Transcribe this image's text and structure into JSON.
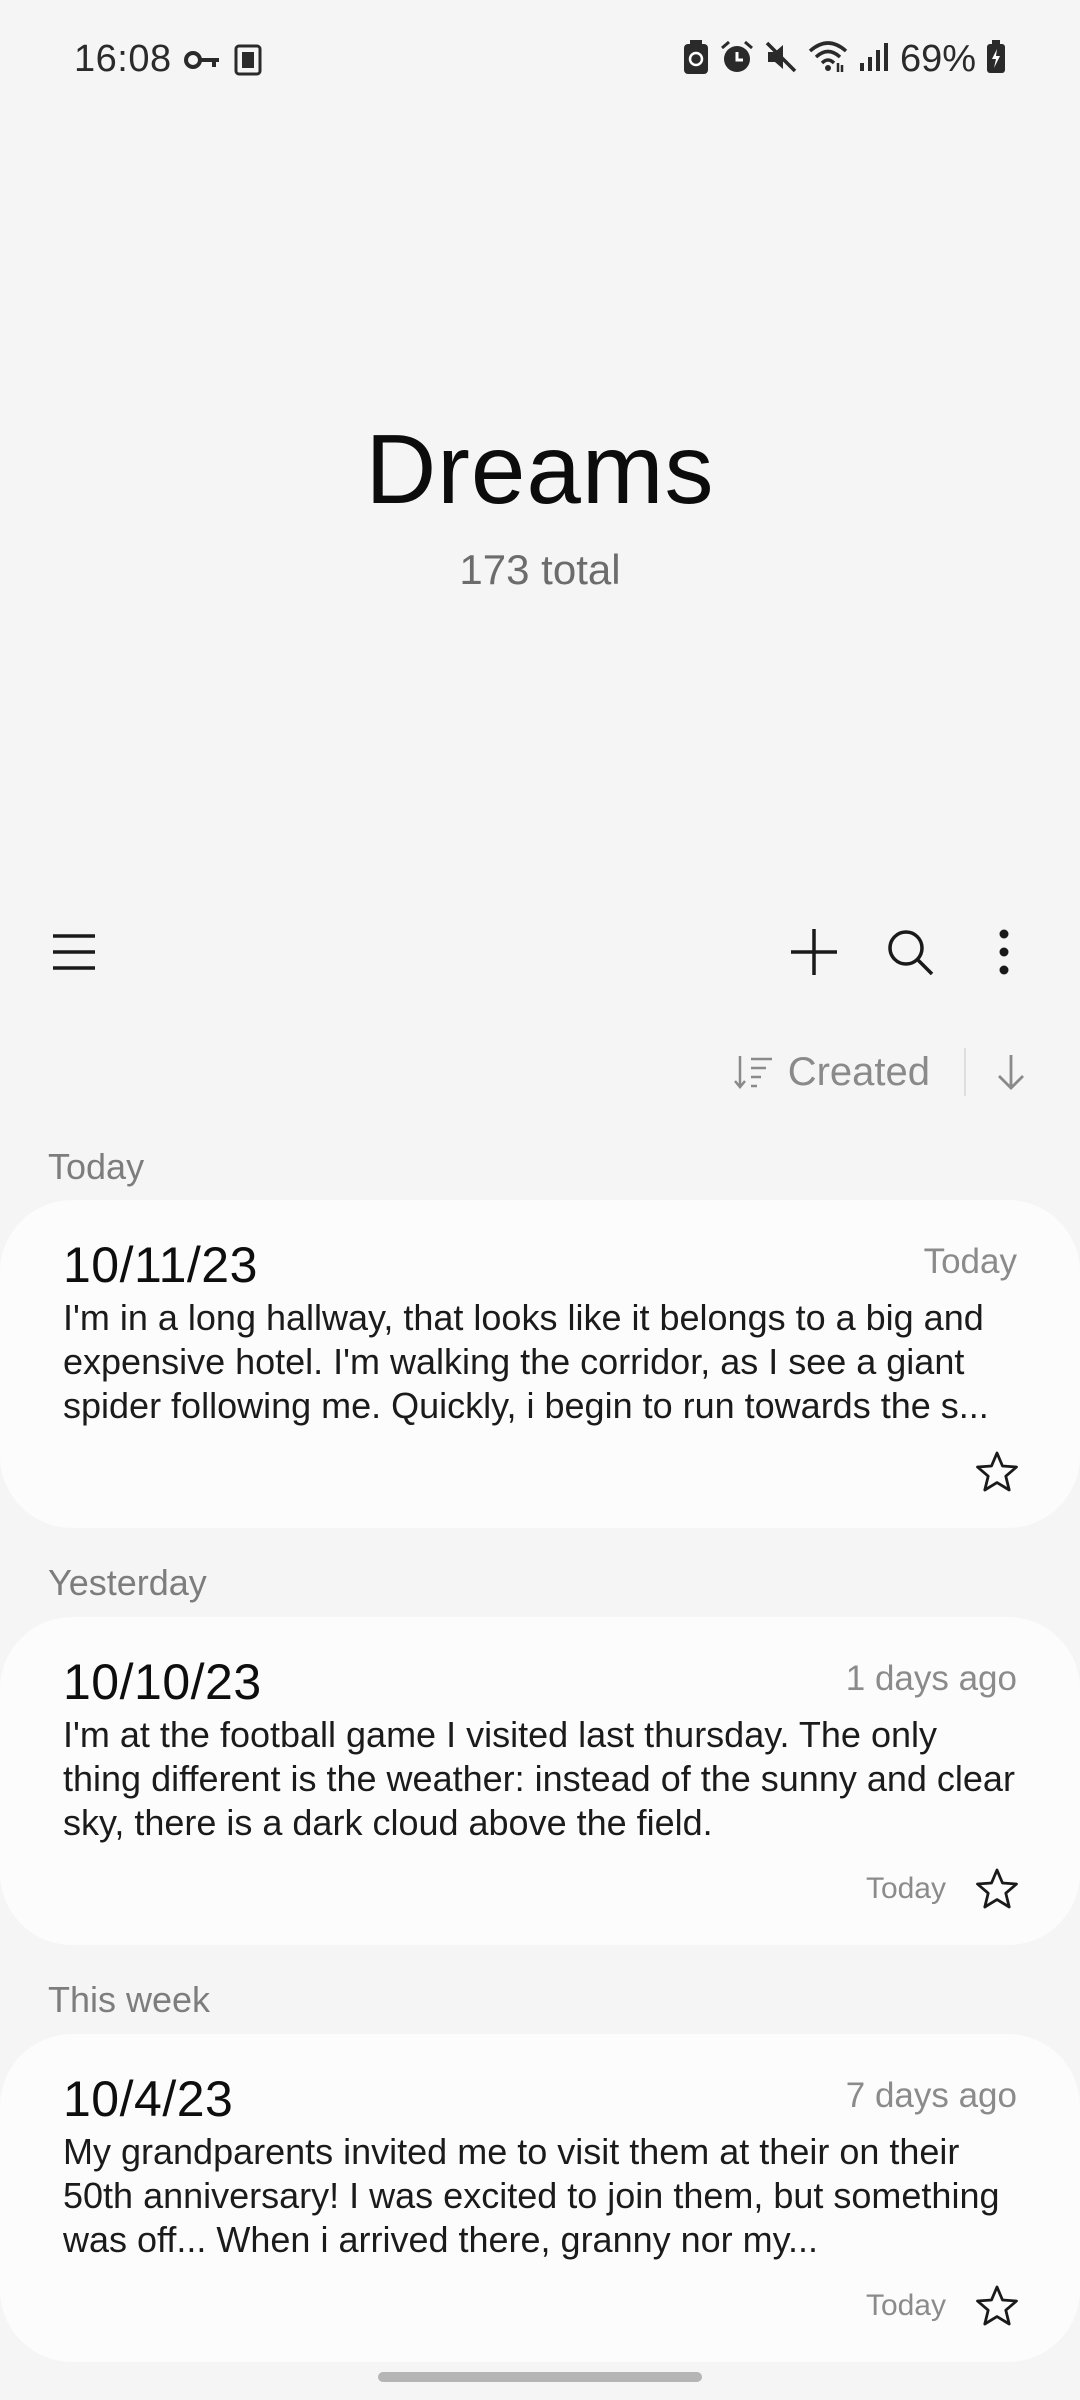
{
  "status_bar": {
    "time": "16:08",
    "battery_percent": "69%",
    "icons": [
      "key-icon",
      "k-app-icon",
      "battery-saver-icon",
      "alarm-icon",
      "mute-icon",
      "wifi-icon",
      "signal-icon",
      "battery-icon"
    ]
  },
  "header": {
    "title": "Dreams",
    "count": "173 total"
  },
  "toolbar": {
    "icons": [
      "menu-icon",
      "add-icon",
      "search-icon",
      "more-icon"
    ]
  },
  "sort": {
    "label": "Created",
    "direction": "descending"
  },
  "sections": [
    {
      "label": "Today",
      "notes": [
        {
          "date": "10/11/23",
          "relative": "Today",
          "modified": "",
          "body": "I'm in a long hallway, that looks like it belongs to a big and expensive hotel. I'm walking the corridor, as I see a giant spider following me. Quickly, i begin to run towards the s..."
        }
      ]
    },
    {
      "label": "Yesterday",
      "notes": [
        {
          "date": "10/10/23",
          "relative": "1 days ago",
          "modified": "Today",
          "body": "I'm at the football game I visited last thursday. The only thing different is the weather: instead of the sunny and clear sky, there is a dark cloud above the field."
        }
      ]
    },
    {
      "label": "This week",
      "notes": [
        {
          "date": "10/4/23",
          "relative": "7 days ago",
          "modified": "Today",
          "body": "My grandparents invited me to visit them at their on their 50th anniversary! I was excited to join them, but something was off... When i arrived there, granny nor my..."
        }
      ]
    }
  ],
  "colors": {
    "background": "#f5f5f5",
    "card": "#fcfcfc",
    "muted_text": "#8b8b8b"
  }
}
